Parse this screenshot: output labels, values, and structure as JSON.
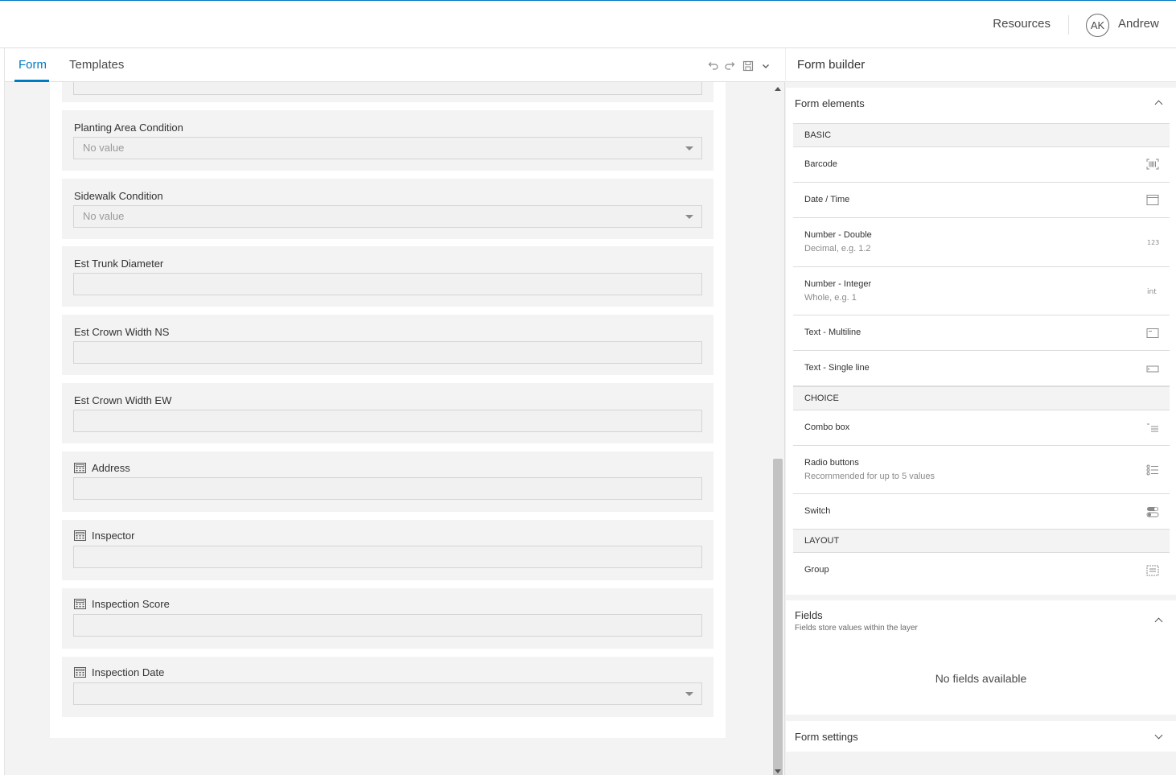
{
  "header": {
    "resources_label": "Resources",
    "avatar_initials": "AK",
    "user_name": "Andrew"
  },
  "left": {
    "tabs": [
      {
        "label": "Form"
      },
      {
        "label": "Templates"
      }
    ],
    "toolbar_icons": [
      "undo-icon",
      "redo-icon",
      "save-icon",
      "chevron-down-icon"
    ],
    "form_fields": [
      {
        "label": "Planting Area Condition",
        "value": "No value",
        "type": "select",
        "calculated": false
      },
      {
        "label": "Sidewalk Condition",
        "value": "No value",
        "type": "select",
        "calculated": false
      },
      {
        "label": "Est Trunk Diameter",
        "value": "",
        "type": "text",
        "calculated": false
      },
      {
        "label": "Est Crown Width NS",
        "value": "",
        "type": "text",
        "calculated": false
      },
      {
        "label": "Est Crown Width EW",
        "value": "",
        "type": "text",
        "calculated": false
      },
      {
        "label": "Address",
        "value": "",
        "type": "text",
        "calculated": true
      },
      {
        "label": "Inspector",
        "value": "",
        "type": "text",
        "calculated": true
      },
      {
        "label": "Inspection Score",
        "value": "",
        "type": "text",
        "calculated": true
      },
      {
        "label": "Inspection Date",
        "value": "",
        "type": "select",
        "calculated": true
      }
    ]
  },
  "builder": {
    "title": "Form builder",
    "form_elements": {
      "title": "Form elements",
      "groups": [
        {
          "name": "BASIC",
          "items": [
            {
              "name": "Barcode",
              "desc": "",
              "icon": "barcode-icon"
            },
            {
              "name": "Date / Time",
              "desc": "",
              "icon": "calendar-icon"
            },
            {
              "name": "Number - Double",
              "desc": "Decimal, e.g. 1.2",
              "icon": "decimal-icon"
            },
            {
              "name": "Number - Integer",
              "desc": "Whole, e.g. 1",
              "icon": "integer-icon"
            },
            {
              "name": "Text - Multiline",
              "desc": "",
              "icon": "multiline-text-icon"
            },
            {
              "name": "Text - Single line",
              "desc": "",
              "icon": "single-line-text-icon"
            }
          ]
        },
        {
          "name": "CHOICE",
          "items": [
            {
              "name": "Combo box",
              "desc": "",
              "icon": "combo-box-icon"
            },
            {
              "name": "Radio buttons",
              "desc": "Recommended for up to 5 values",
              "icon": "radio-list-icon"
            },
            {
              "name": "Switch",
              "desc": "",
              "icon": "switch-icon"
            }
          ]
        },
        {
          "name": "LAYOUT",
          "items": [
            {
              "name": "Group",
              "desc": "",
              "icon": "group-icon"
            }
          ]
        }
      ]
    },
    "fields": {
      "title": "Fields",
      "subtitle": "Fields store values within the layer",
      "empty_text": "No fields available"
    },
    "form_settings": {
      "title": "Form settings"
    }
  }
}
